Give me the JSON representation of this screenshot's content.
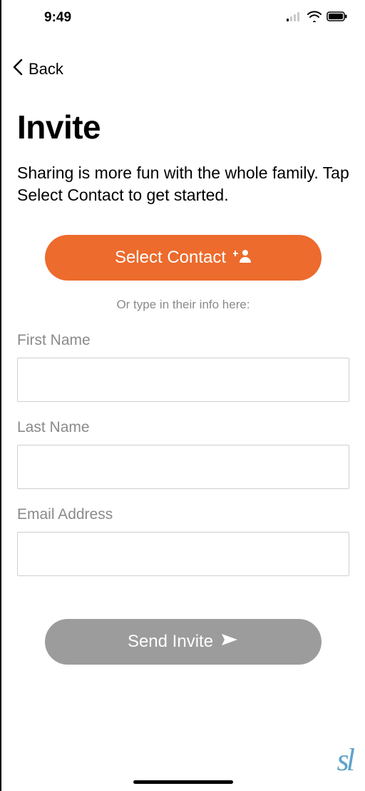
{
  "status": {
    "time": "9:49"
  },
  "nav": {
    "back_label": "Back"
  },
  "header": {
    "title": "Invite",
    "subtitle": "Sharing is more fun with the whole family. Tap Select Contact to get started."
  },
  "buttons": {
    "select_contact": "Select Contact",
    "send_invite": "Send Invite"
  },
  "divider": "Or type in their info here:",
  "form": {
    "first_name_label": "First Name",
    "first_name_value": "",
    "last_name_label": "Last Name",
    "last_name_value": "",
    "email_label": "Email Address",
    "email_value": ""
  },
  "watermark": "sl"
}
